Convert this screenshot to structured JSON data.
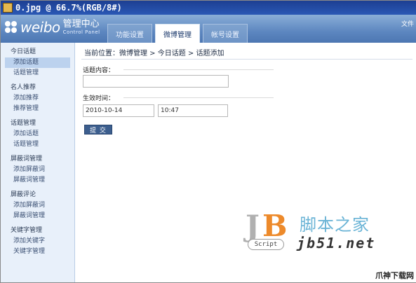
{
  "window_title": "0.jpg @ 66.7%(RGB/8#)",
  "brand": {
    "name": "weibo",
    "cn_title": "管理中心",
    "subtitle": "Control Panel"
  },
  "header_right": "文件",
  "tabs": [
    {
      "label": "功能设置",
      "active": false
    },
    {
      "label": "微博管理",
      "active": true
    },
    {
      "label": "帐号设置",
      "active": false
    }
  ],
  "sidebar": [
    {
      "title": "今日话题",
      "items": [
        {
          "label": "添加话题",
          "selected": true
        },
        {
          "label": "话题管理",
          "selected": false
        }
      ]
    },
    {
      "title": "名人推荐",
      "items": [
        {
          "label": "添加推荐",
          "selected": false
        },
        {
          "label": "推荐管理",
          "selected": false
        }
      ]
    },
    {
      "title": "话题管理",
      "items": [
        {
          "label": "添加话题",
          "selected": false
        },
        {
          "label": "话题管理",
          "selected": false
        }
      ]
    },
    {
      "title": "屏蔽词管理",
      "items": [
        {
          "label": "添加屏蔽词",
          "selected": false
        },
        {
          "label": "屏蔽词管理",
          "selected": false
        }
      ]
    },
    {
      "title": "屏蔽评论",
      "items": [
        {
          "label": "添加屏蔽词",
          "selected": false
        },
        {
          "label": "屏蔽词管理",
          "selected": false
        }
      ]
    },
    {
      "title": "关键字管理",
      "items": [
        {
          "label": "添加关键字",
          "selected": false
        },
        {
          "label": "关键字管理",
          "selected": false
        }
      ]
    }
  ],
  "breadcrumb": "当前位置：微博管理 > 今日话题 > 话题添加",
  "form": {
    "content_label": "话题内容：",
    "content_value": "",
    "time_label": "生效时间：",
    "date_value": "2010-10-14",
    "time_value": "10:47",
    "submit_label": "提 交"
  },
  "watermark": {
    "script_label": "Script",
    "cn_text": "脚本之家",
    "url": "jb51.net",
    "corner": "爪神下载网"
  }
}
